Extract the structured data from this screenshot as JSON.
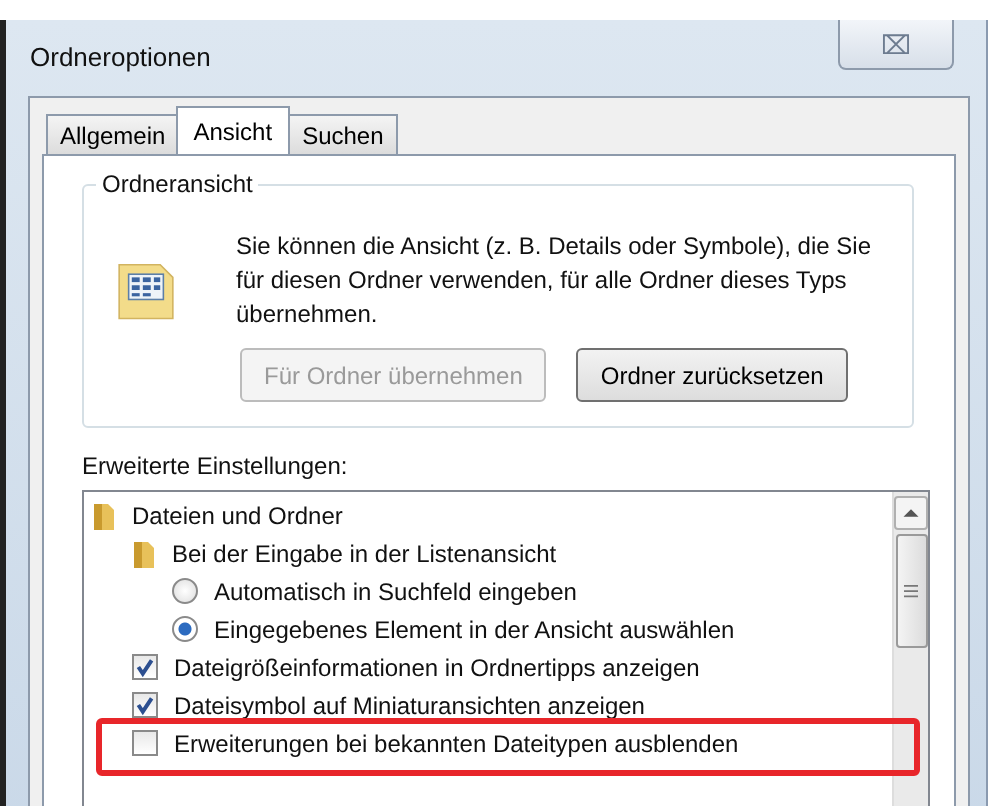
{
  "window": {
    "title": "Ordneroptionen",
    "close": "⌧"
  },
  "tabs": [
    {
      "label": "Allgemein",
      "selected": false
    },
    {
      "label": "Ansicht",
      "selected": true
    },
    {
      "label": "Suchen",
      "selected": false
    }
  ],
  "folder_view": {
    "title": "Ordneransicht",
    "description": "Sie können die Ansicht (z. B. Details oder Symbole), die Sie für diesen Ordner verwenden, für alle Ordner dieses Typs übernehmen.",
    "buttons": [
      {
        "label": "Für Ordner übernehmen",
        "disabled": true
      },
      {
        "label": "Ordner zurücksetzen",
        "disabled": false
      }
    ]
  },
  "advanced": {
    "title": "Erweiterte Einstellungen:",
    "items": [
      {
        "kind": "folder",
        "label": "Dateien und Ordner",
        "children": [
          {
            "kind": "folder",
            "label": "Bei der Eingabe in der Listenansicht",
            "children": [
              {
                "kind": "radio",
                "label": "Automatisch in Suchfeld eingeben",
                "selected": false
              },
              {
                "kind": "radio",
                "label": "Eingegebenes Element in der Ansicht auswählen",
                "selected": true
              }
            ]
          },
          {
            "kind": "checkbox",
            "label": "Dateigrößeinformationen in Ordnertipps anzeigen",
            "checked": true
          },
          {
            "kind": "checkbox",
            "label": "Dateisymbol auf Miniaturansichten anzeigen",
            "checked": true
          },
          {
            "kind": "checkbox",
            "label": "Erweiterungen bei bekannten Dateitypen ausblenden",
            "checked": false,
            "highlighted": true
          }
        ]
      }
    ]
  }
}
